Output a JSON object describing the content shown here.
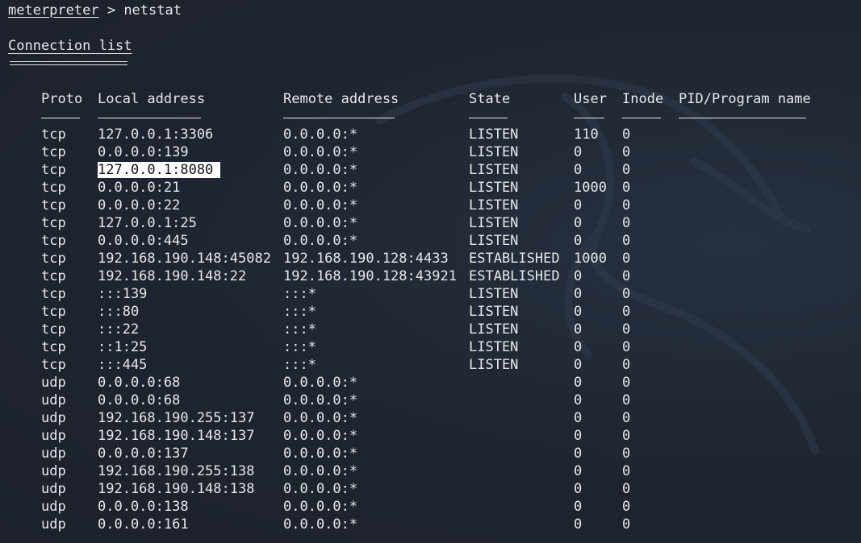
{
  "prompt": {
    "name": "meterpreter",
    "separator": " > ",
    "command": "netstat"
  },
  "section_title": "Connection list",
  "columns": [
    "Proto",
    "Local address",
    "Remote address",
    "State",
    "User",
    "Inode",
    "PID/Program name"
  ],
  "rows": [
    {
      "proto": "tcp",
      "local": "127.0.0.1:3306",
      "remote": "0.0.0.0:*",
      "state": "LISTEN",
      "user": "110",
      "inode": "0",
      "pid": "",
      "highlighted": false
    },
    {
      "proto": "tcp",
      "local": "0.0.0.0:139",
      "remote": "0.0.0.0:*",
      "state": "LISTEN",
      "user": "0",
      "inode": "0",
      "pid": "",
      "highlighted": false
    },
    {
      "proto": "tcp",
      "local": "127.0.0.1:8080",
      "remote": "0.0.0.0:*",
      "state": "LISTEN",
      "user": "0",
      "inode": "0",
      "pid": "",
      "highlighted": true
    },
    {
      "proto": "tcp",
      "local": "0.0.0.0:21",
      "remote": "0.0.0.0:*",
      "state": "LISTEN",
      "user": "1000",
      "inode": "0",
      "pid": "",
      "highlighted": false
    },
    {
      "proto": "tcp",
      "local": "0.0.0.0:22",
      "remote": "0.0.0.0:*",
      "state": "LISTEN",
      "user": "0",
      "inode": "0",
      "pid": "",
      "highlighted": false
    },
    {
      "proto": "tcp",
      "local": "127.0.0.1:25",
      "remote": "0.0.0.0:*",
      "state": "LISTEN",
      "user": "0",
      "inode": "0",
      "pid": "",
      "highlighted": false
    },
    {
      "proto": "tcp",
      "local": "0.0.0.0:445",
      "remote": "0.0.0.0:*",
      "state": "LISTEN",
      "user": "0",
      "inode": "0",
      "pid": "",
      "highlighted": false
    },
    {
      "proto": "tcp",
      "local": "192.168.190.148:45082",
      "remote": "192.168.190.128:4433",
      "state": "ESTABLISHED",
      "user": "1000",
      "inode": "0",
      "pid": "",
      "highlighted": false
    },
    {
      "proto": "tcp",
      "local": "192.168.190.148:22",
      "remote": "192.168.190.128:43921",
      "state": "ESTABLISHED",
      "user": "0",
      "inode": "0",
      "pid": "",
      "highlighted": false
    },
    {
      "proto": "tcp",
      "local": ":::139",
      "remote": ":::*",
      "state": "LISTEN",
      "user": "0",
      "inode": "0",
      "pid": "",
      "highlighted": false
    },
    {
      "proto": "tcp",
      "local": ":::80",
      "remote": ":::*",
      "state": "LISTEN",
      "user": "0",
      "inode": "0",
      "pid": "",
      "highlighted": false
    },
    {
      "proto": "tcp",
      "local": ":::22",
      "remote": ":::*",
      "state": "LISTEN",
      "user": "0",
      "inode": "0",
      "pid": "",
      "highlighted": false
    },
    {
      "proto": "tcp",
      "local": "::1:25",
      "remote": ":::*",
      "state": "LISTEN",
      "user": "0",
      "inode": "0",
      "pid": "",
      "highlighted": false
    },
    {
      "proto": "tcp",
      "local": ":::445",
      "remote": ":::*",
      "state": "LISTEN",
      "user": "0",
      "inode": "0",
      "pid": "",
      "highlighted": false
    },
    {
      "proto": "udp",
      "local": "0.0.0.0:68",
      "remote": "0.0.0.0:*",
      "state": "",
      "user": "0",
      "inode": "0",
      "pid": "",
      "highlighted": false
    },
    {
      "proto": "udp",
      "local": "0.0.0.0:68",
      "remote": "0.0.0.0:*",
      "state": "",
      "user": "0",
      "inode": "0",
      "pid": "",
      "highlighted": false
    },
    {
      "proto": "udp",
      "local": "192.168.190.255:137",
      "remote": "0.0.0.0:*",
      "state": "",
      "user": "0",
      "inode": "0",
      "pid": "",
      "highlighted": false
    },
    {
      "proto": "udp",
      "local": "192.168.190.148:137",
      "remote": "0.0.0.0:*",
      "state": "",
      "user": "0",
      "inode": "0",
      "pid": "",
      "highlighted": false
    },
    {
      "proto": "udp",
      "local": "0.0.0.0:137",
      "remote": "0.0.0.0:*",
      "state": "",
      "user": "0",
      "inode": "0",
      "pid": "",
      "highlighted": false
    },
    {
      "proto": "udp",
      "local": "192.168.190.255:138",
      "remote": "0.0.0.0:*",
      "state": "",
      "user": "0",
      "inode": "0",
      "pid": "",
      "highlighted": false
    },
    {
      "proto": "udp",
      "local": "192.168.190.148:138",
      "remote": "0.0.0.0:*",
      "state": "",
      "user": "0",
      "inode": "0",
      "pid": "",
      "highlighted": false
    },
    {
      "proto": "udp",
      "local": "0.0.0.0:138",
      "remote": "0.0.0.0:*",
      "state": "",
      "user": "0",
      "inode": "0",
      "pid": "",
      "highlighted": false
    },
    {
      "proto": "udp",
      "local": "0.0.0.0:161",
      "remote": "0.0.0.0:*",
      "state": "",
      "user": "0",
      "inode": "0",
      "pid": "",
      "highlighted": false
    }
  ],
  "colors": {
    "background": "#1f2430",
    "text": "#e6e8ea",
    "highlight_bg": "#ffffff",
    "highlight_text": "#111111"
  },
  "background_art": "kali-dragon-watermark"
}
